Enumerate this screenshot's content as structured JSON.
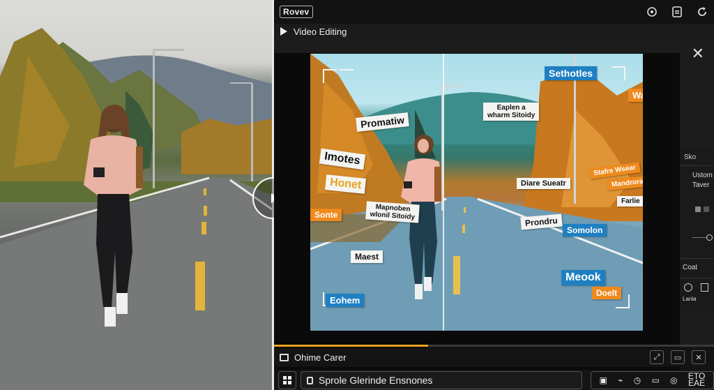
{
  "app": {
    "logo": "Rovev",
    "window_title": "Video Editing",
    "top_icons": [
      "badge-icon",
      "document-icon",
      "refresh-icon"
    ],
    "accent_color": "#e8a21c"
  },
  "viewer": {
    "tags": [
      {
        "text": "Sethotles",
        "style": "blue"
      },
      {
        "text": "Wan?",
        "style": "orange"
      },
      {
        "text": "Eaplen a",
        "line2": "wharm Sitoidy",
        "style": "white"
      },
      {
        "text": "Promatiw",
        "style": "white"
      },
      {
        "text": "Imotes",
        "style": "white"
      },
      {
        "text": "Honet",
        "style": "white-orange"
      },
      {
        "text": "Sonte",
        "style": "orange"
      },
      {
        "text": "Mapnoben",
        "line2": "wlonil Sitoidy",
        "style": "white"
      },
      {
        "text": "Diare Sueatr",
        "style": "white"
      },
      {
        "text": "Stafre Wsear",
        "style": "orange"
      },
      {
        "text": "Mandroral",
        "style": "orange"
      },
      {
        "text": "Farlie",
        "style": "white"
      },
      {
        "text": "Prondru",
        "style": "white"
      },
      {
        "text": "Somolon",
        "style": "blue"
      },
      {
        "text": "Maest",
        "style": "white"
      },
      {
        "text": "Meook",
        "style": "blue"
      },
      {
        "text": "Doelt",
        "style": "orange"
      },
      {
        "text": "Eohem",
        "style": "blue"
      }
    ]
  },
  "right_panel": {
    "tab": "Sko",
    "line1": "Ustom",
    "line2": "Taver",
    "section": "Coat",
    "bottom_label": "Lanla"
  },
  "timeline": {
    "progress": 0.35
  },
  "bottom_bar": {
    "label": "Ohime Carer",
    "action_icons": [
      "expand-icon",
      "frame-icon",
      "close-box-icon"
    ]
  },
  "search_bar": {
    "value": "Sprole Glerinde Ensnones"
  },
  "tool_strip": {
    "icons": [
      "camera-icon",
      "route-icon",
      "clock-icon",
      "monitor-icon",
      "target-icon"
    ],
    "small_label_top": "ETO",
    "small_label_bottom": "EAE"
  }
}
